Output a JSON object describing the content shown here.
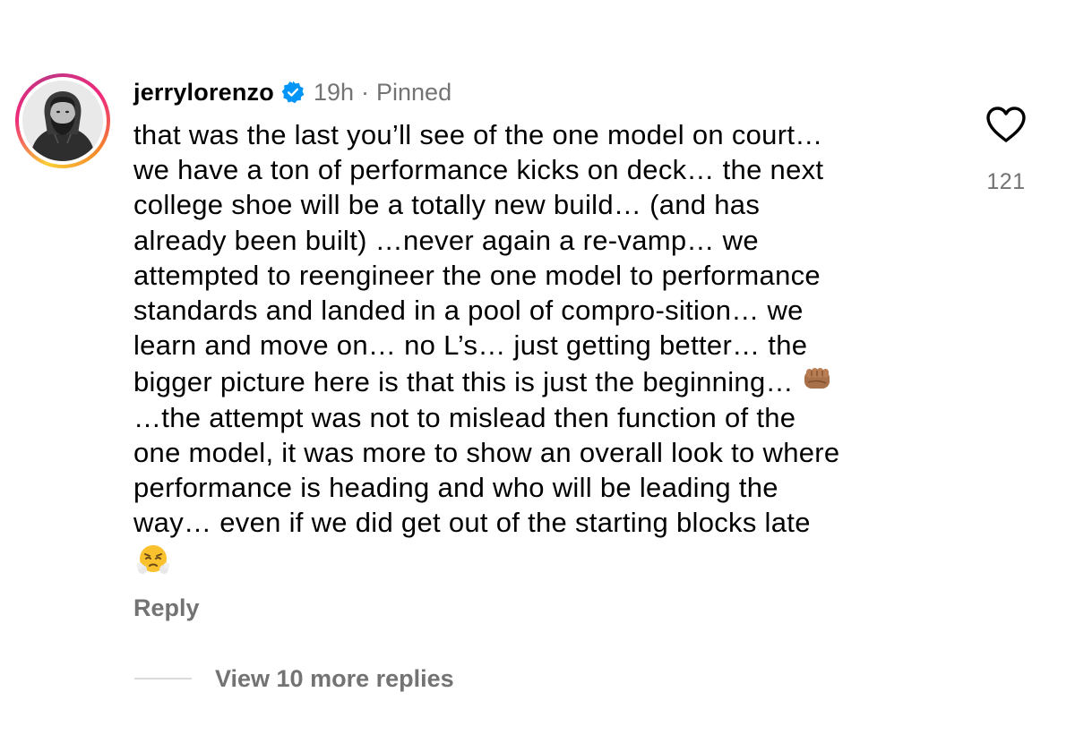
{
  "comment": {
    "username": "jerrylorenzo",
    "timestamp": "19h",
    "separator": "·",
    "pinned_label": "Pinned",
    "avatar_icon": "avatar-photo-bearded-man",
    "verified_icon": "verified-badge-icon",
    "text_lines": [
      "that was the last you’ll see of the one model on court…",
      "we have a ton of performance kicks on deck… the next",
      "college shoe will be a totally new build… (and has",
      "already been built) …never again a re-vamp… we",
      "attempted to reengineer the one model to performance",
      "standards and landed in a pool of compro-sition… we",
      "learn and move on… no L’s… just getting better… the",
      "bigger picture here is that this is just the beginning…",
      "…the attempt was not to mislead then function of the",
      "one model, it was more to show an overall look to where",
      "performance is heading and who will be leading the",
      "way… even if we did get out of the starting blocks late"
    ],
    "emoji_fist": "oncoming-fist-emoji",
    "emoji_steam": "face-with-steam-from-nose-emoji",
    "reply_label": "Reply",
    "like_icon": "heart-outline-icon",
    "like_count": "121",
    "view_replies_label": "View 10 more replies"
  },
  "colors": {
    "primary_text": "#000000",
    "secondary_text": "#737373",
    "verified_blue": "#0095f6",
    "divider": "#dbdbdb"
  }
}
